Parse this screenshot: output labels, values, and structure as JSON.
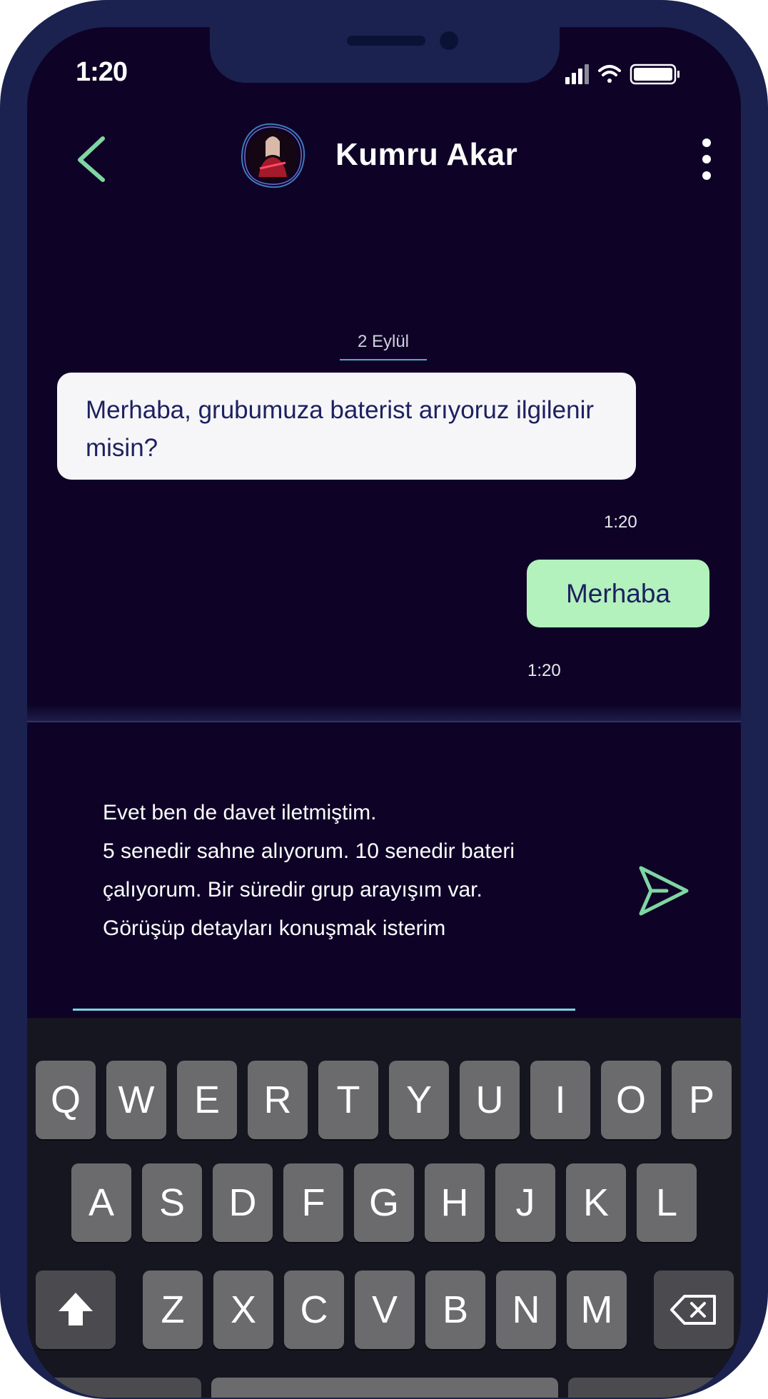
{
  "status_bar": {
    "time": "1:20"
  },
  "header": {
    "contact_name": "Kumru Akar"
  },
  "chat": {
    "date_separator": "2 Eylül",
    "messages": [
      {
        "direction": "incoming",
        "text": "Merhaba, grubumuza baterist arıyoruz ilgilenir misin?",
        "time": "1:20"
      },
      {
        "direction": "outgoing",
        "text": "Merhaba",
        "time": "1:20"
      }
    ]
  },
  "composer": {
    "text": "Evet ben de davet iletmiştim.\n5 senedir sahne alıyorum. 10 senedir bateri çalıyorum. Bir süredir grup arayışım var. Görüşüp detayları konuşmak isterim"
  },
  "keyboard": {
    "row1": [
      "Q",
      "W",
      "E",
      "R",
      "T",
      "Y",
      "U",
      "I",
      "O",
      "P"
    ],
    "row2": [
      "A",
      "S",
      "D",
      "F",
      "G",
      "H",
      "J",
      "K",
      "L"
    ],
    "row3": [
      "Z",
      "X",
      "C",
      "V",
      "B",
      "N",
      "M"
    ]
  },
  "colors": {
    "background": "#0e0327",
    "frame": "#1b2250",
    "accent_green": "#7fd6a2",
    "outgoing_bubble": "#b3f1bd",
    "incoming_bubble": "#f6f6f8",
    "underline": "#79d7dc"
  },
  "icons": {
    "back": "chevron-left-icon",
    "more": "more-vertical-icon",
    "send": "send-icon",
    "shift": "shift-icon",
    "delete": "backspace-icon"
  }
}
